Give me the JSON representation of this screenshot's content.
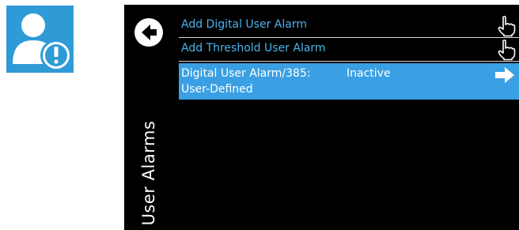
{
  "app": {
    "icon_name": "user-alert-icon",
    "icon_color": "#2f9bd6"
  },
  "sidebar": {
    "back_icon": "back-arrow-icon",
    "title": "User Alarms"
  },
  "menu": {
    "items": [
      {
        "label": "Add Digital User Alarm",
        "icon": "hand-pointer-icon"
      },
      {
        "label": "Add Threshold User Alarm",
        "icon": "hand-pointer-icon"
      }
    ],
    "selected": {
      "label": "Digital User Alarm/385:",
      "status": "Inactive",
      "sublabel": "User-Defined",
      "icon": "arrow-right-icon"
    }
  },
  "colors": {
    "background": "#000000",
    "link_text": "#4db2ee",
    "selection": "#3aa0e3",
    "divider": "#d9d9d9"
  }
}
